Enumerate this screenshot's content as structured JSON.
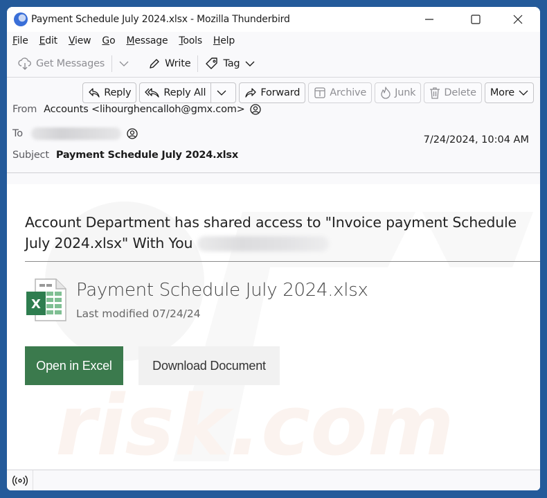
{
  "window": {
    "title": "Payment Schedule July 2024.xlsx - Mozilla Thunderbird",
    "app_icon": "thunderbird-icon",
    "controls": {
      "minimize": "minimize-icon",
      "maximize": "maximize-icon",
      "close": "close-icon"
    }
  },
  "menubar": {
    "items": [
      {
        "label": "File",
        "accel": "F",
        "rest": "ile"
      },
      {
        "label": "Edit",
        "accel": "E",
        "rest": "dit"
      },
      {
        "label": "View",
        "accel": "V",
        "rest": "iew"
      },
      {
        "label": "Go",
        "accel": "G",
        "rest": "o"
      },
      {
        "label": "Message",
        "accel": "M",
        "rest": "essage"
      },
      {
        "label": "Tools",
        "accel": "T",
        "rest": "ools"
      },
      {
        "label": "Help",
        "accel": "H",
        "rest": "elp"
      }
    ]
  },
  "toolbar": {
    "get_messages": "Get Messages",
    "write": "Write",
    "tag": "Tag"
  },
  "header_buttons": {
    "reply": "Reply",
    "reply_all": "Reply All",
    "forward": "Forward",
    "archive": "Archive",
    "junk": "Junk",
    "delete": "Delete",
    "more": "More"
  },
  "message_header": {
    "from_label": "From",
    "from_value": "Accounts <lihourghencalloh@gmx.com>",
    "to_label": "To",
    "to_value": "",
    "subject_label": "Subject",
    "subject_value": "Payment Schedule July 2024.xlsx",
    "date": "7/24/2024, 10:04 AM"
  },
  "body": {
    "intro": "Account Department has shared access to \"Invoice payment Schedule July 2024.xlsx\" With You",
    "file_name": "Payment Schedule July 2024.xlsx",
    "last_modified": "Last modified 07/24/24",
    "open_button": "Open in Excel",
    "download_button": "Download Document",
    "colors": {
      "open_button": "#3b7a4d",
      "download_button": "#f1f1f1"
    }
  },
  "statusbar": {
    "icon": "activity-icon"
  }
}
